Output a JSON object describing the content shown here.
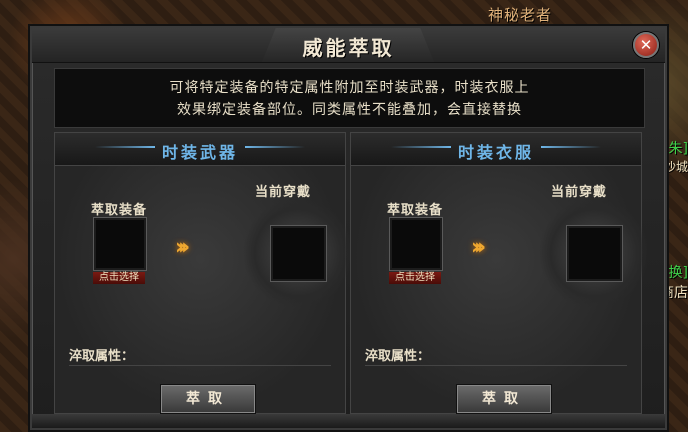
{
  "scene": {
    "npc_name": "神秘老者",
    "side_texts": [
      "朱]",
      "沙城",
      "换]",
      "商店"
    ]
  },
  "dialog": {
    "title": "威能萃取",
    "close_symbol": "✕",
    "description": [
      "可将特定装备的特定属性附加至时装武器，时装衣服上",
      "效果绑定装备部位。同类属性不能叠加，会直接替换"
    ],
    "panels": [
      {
        "title": "时装武器",
        "extract_label": "萃取装备",
        "current_label": "当前穿戴",
        "pick_label": "点击选择",
        "attr_label": "淬取属性：",
        "action_label": "萃取"
      },
      {
        "title": "时装衣服",
        "extract_label": "萃取装备",
        "current_label": "当前穿戴",
        "pick_label": "点击选择",
        "attr_label": "淬取属性：",
        "action_label": "萃取"
      }
    ]
  }
}
